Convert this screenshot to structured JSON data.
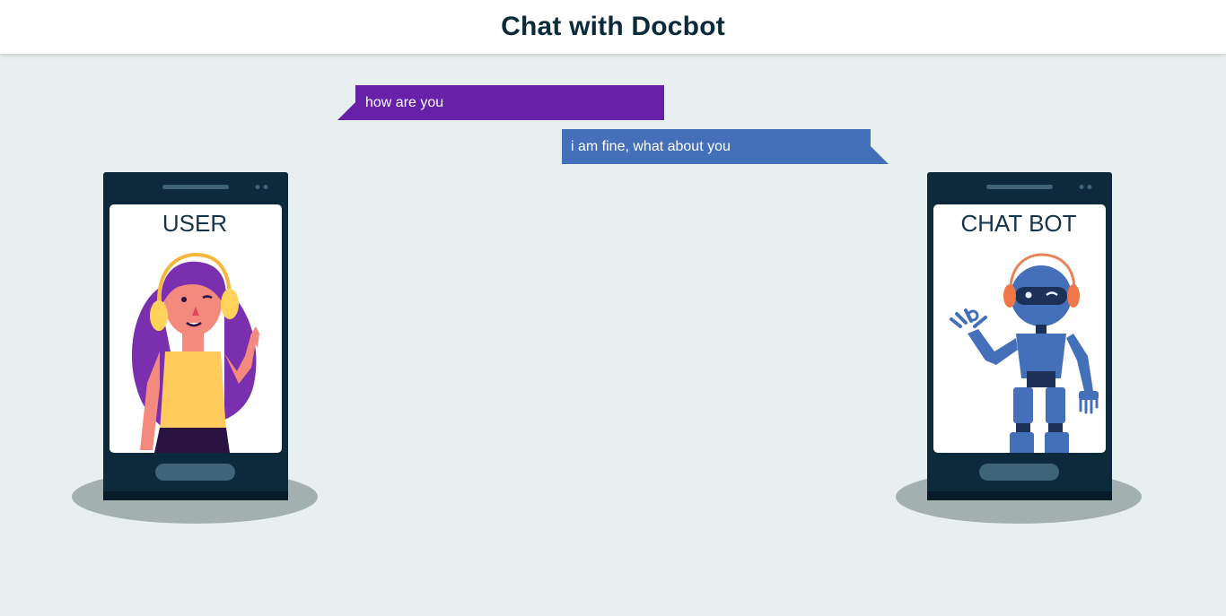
{
  "header": {
    "title": "Chat with Docbot"
  },
  "chat": {
    "messages": [
      {
        "sender": "user",
        "text": "how are you"
      },
      {
        "sender": "bot",
        "text": "i am fine, what about you"
      }
    ]
  },
  "panels": {
    "user": {
      "label": "USER"
    },
    "bot": {
      "label": "CHAT BOT"
    }
  },
  "colors": {
    "user_bubble": "#6621a8",
    "bot_bubble": "#4470b9",
    "background": "#e7f0ef",
    "phone_body": "#0d2a3c"
  },
  "icons": [
    "user-avatar-illustration",
    "chatbot-robot-illustration",
    "phone-device"
  ]
}
